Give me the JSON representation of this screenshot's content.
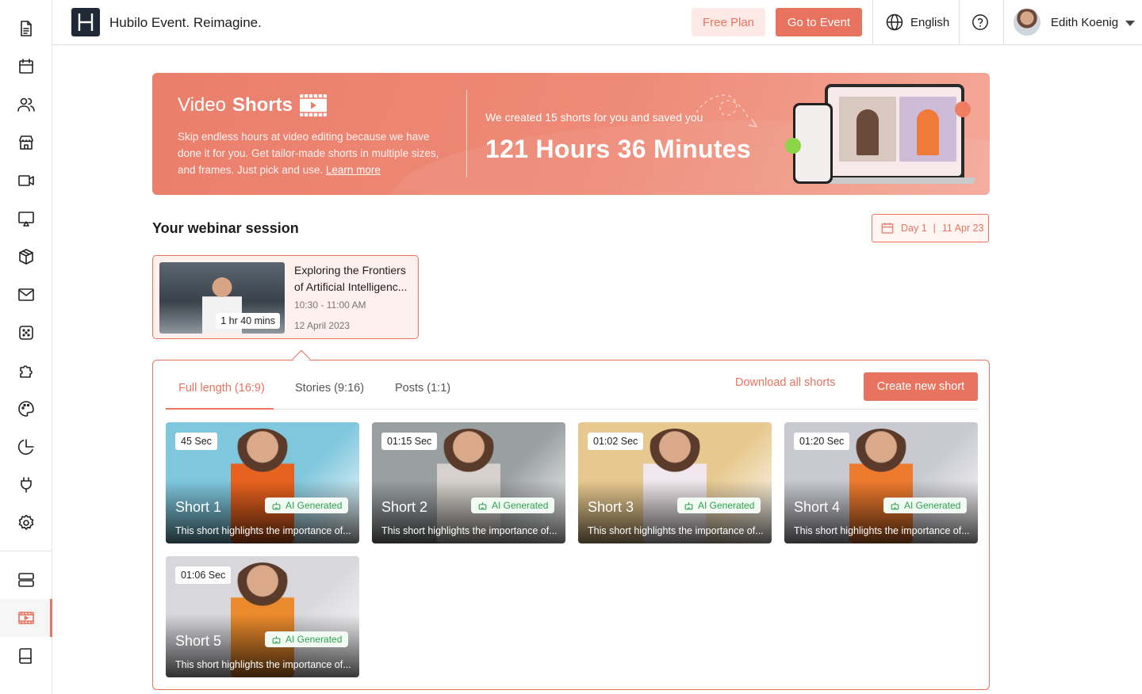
{
  "header": {
    "app_title": "Hubilo Event. Reimagine.",
    "free_plan_label": "Free Plan",
    "go_to_event_label": "Go to Event",
    "language": "English",
    "user_name": "Edith Koenig"
  },
  "banner": {
    "title_regular": "Video",
    "title_bold": "Shorts",
    "description": "Skip endless hours at video editing because we have done it for you. Get tailor-made shorts in multiple sizes, and frames. Just pick and use.",
    "learn_more": "Learn more",
    "saved_label": "We created 15 shorts for you and saved you",
    "saved_value": "121 Hours 36 Minutes"
  },
  "session_section": {
    "title": "Your webinar session",
    "day": "Day 1",
    "date": "11 Apr 23"
  },
  "session": {
    "name": "Exploring the Frontiers of Artificial Intelligenc...",
    "time": "10:30 - 11:00 AM",
    "date": "12 April 2023",
    "duration": "1 hr 40 mins"
  },
  "tabs": [
    {
      "label": "Full length (16:9)",
      "active": true
    },
    {
      "label": "Stories (9:16)",
      "active": false
    },
    {
      "label": "Posts (1:1)",
      "active": false
    }
  ],
  "actions": {
    "download_all": "Download all shorts",
    "create_new": "Create new short"
  },
  "shorts": [
    {
      "name": "Short 1",
      "duration": "45 Sec",
      "badge": "AI Generated",
      "description": "This short highlights the importance of...",
      "bg": "#7fc7dd",
      "shirt": "#e8621f"
    },
    {
      "name": "Short 2",
      "duration": "01:15 Sec",
      "badge": "AI Generated",
      "description": "This short highlights the importance of...",
      "bg": "#9aa0a2",
      "shirt": "#d6d1cc"
    },
    {
      "name": "Short 3",
      "duration": "01:02 Sec",
      "badge": "AI Generated",
      "description": "This short highlights the importance of...",
      "bg": "#e7c98f",
      "shirt": "#f0e8ec"
    },
    {
      "name": "Short 4",
      "duration": "01:20 Sec",
      "badge": "AI Generated",
      "description": "This short highlights the importance of...",
      "bg": "#c9c9d2",
      "shirt": "#ee7a2e"
    },
    {
      "name": "Short 5",
      "duration": "01:06 Sec",
      "badge": "AI Generated",
      "description": "This short highlights the importance of...",
      "bg": "#d8d8dc",
      "shirt": "#ea8a2c"
    }
  ],
  "colors": {
    "accent": "#e8735f",
    "ai_green": "#2e9e4f"
  }
}
